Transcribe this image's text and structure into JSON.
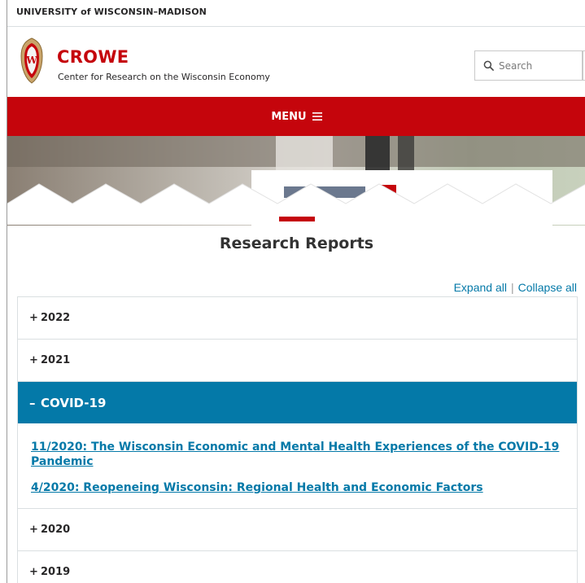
{
  "topbar": {
    "university": "UNIVERSITY of WISCONSIN–MADISON"
  },
  "header": {
    "title": "CROWE",
    "subtitle": "Center for Research on the Wisconsin Economy",
    "crest_icon": "uw-crest-icon"
  },
  "search": {
    "placeholder": "Search",
    "icon": "search-icon"
  },
  "menu": {
    "label": "MENU",
    "icon": "hamburger-icon"
  },
  "page": {
    "title": "Research Reports"
  },
  "controls": {
    "expand": "Expand all",
    "separator": "|",
    "collapse": "Collapse all"
  },
  "accordion": {
    "items": [
      {
        "sign": "+",
        "label": "2022"
      },
      {
        "sign": "+",
        "label": "2021"
      },
      {
        "sign": "–",
        "label": "COVID-19",
        "open": true,
        "links": [
          "11/2020: The Wisconsin Economic and Mental Health Experiences of the COVID-19 Pandemic",
          "4/2020: Reopeneing Wisconsin: Regional Health and Economic Factors"
        ]
      },
      {
        "sign": "+",
        "label": "2020"
      },
      {
        "sign": "+",
        "label": "2019"
      }
    ]
  },
  "colors": {
    "brand_red": "#c5050c",
    "accent_blue": "#0479a8",
    "text": "#282728"
  }
}
